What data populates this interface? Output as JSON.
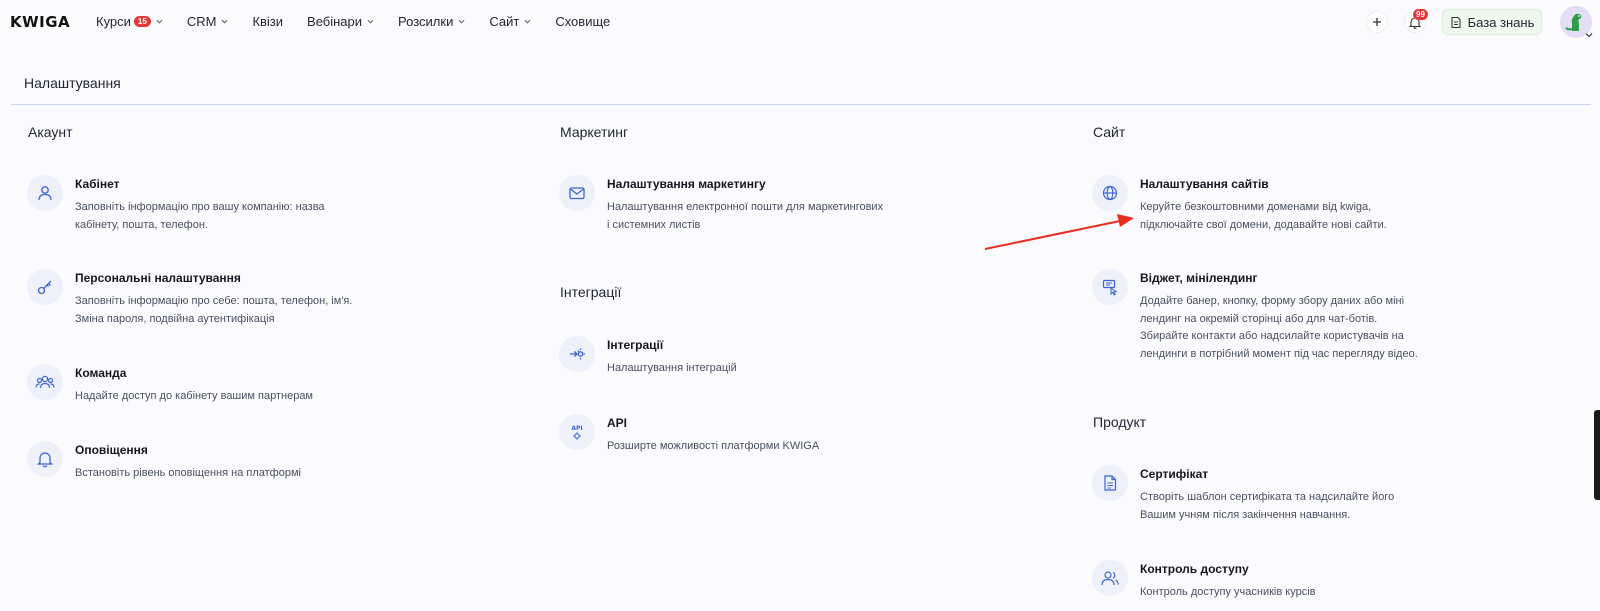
{
  "app": {
    "logo": "KWIGA",
    "nav": [
      {
        "label": "Курси",
        "badge": "15",
        "dropdown": true
      },
      {
        "label": "CRM",
        "dropdown": true
      },
      {
        "label": "Квізи",
        "dropdown": false
      },
      {
        "label": "Вебінари",
        "dropdown": true
      },
      {
        "label": "Розсилки",
        "dropdown": true
      },
      {
        "label": "Сайт",
        "dropdown": true
      },
      {
        "label": "Сховище",
        "dropdown": false
      }
    ],
    "notifications_count": "99",
    "knowledge_base_label": "База знань"
  },
  "page": {
    "title": "Налаштування"
  },
  "sections": {
    "account": {
      "title": "Акаунт",
      "items": [
        {
          "title": "Кабінет",
          "desc": "Заповніть інформацію про вашу компанію: назва\nкабінету, пошта, телефон.",
          "icon": "user-icon"
        },
        {
          "title": "Персональні налаштування",
          "desc": "Заповніть інформацію про себе: пошта, телефон, ім'я.\nЗміна пароля, подвійна аутентифікація",
          "icon": "key-icon"
        },
        {
          "title": "Команда",
          "desc": "Надайте доступ до кабінету вашим партнерам",
          "icon": "team-icon"
        },
        {
          "title": "Оповіщення",
          "desc": "Встановіть рівень оповіщення на платформі",
          "icon": "bell-icon"
        }
      ]
    },
    "marketing": {
      "title": "Маркетинг",
      "items": [
        {
          "title": "Налаштування маркетингу",
          "desc": "Налаштування електронної пошти для маркетингових\nі системних листів",
          "icon": "mail-icon"
        }
      ]
    },
    "integrations": {
      "title": "Інтеграції",
      "items": [
        {
          "title": "Інтеграції",
          "desc": "Налаштування інтеграцій",
          "icon": "integration-icon"
        },
        {
          "title": "API",
          "desc": "Розширте можливості платформи KWIGA",
          "icon": "api-icon"
        }
      ]
    },
    "site": {
      "title": "Сайт",
      "items": [
        {
          "title": "Налаштування сайтів",
          "desc": "Керуйте безкоштовними доменами від kwiga,\nпідключайте свої домени, додавайте нові сайти.",
          "icon": "globe-icon"
        },
        {
          "title": "Віджет, мінілендинг",
          "desc": "Додайте банер, кнопку, форму збору даних або міні\nлендинг на окремій сторінці або для чат-ботів.\nЗбирайте контакти або надсилайте користувачів на\nлендинги в потрібний момент під час перегляду відео.",
          "icon": "widget-icon"
        }
      ]
    },
    "product": {
      "title": "Продукт",
      "items": [
        {
          "title": "Сертифікат",
          "desc": "Створіть шаблон сертифіката та надсилайте його\nВашим учням після закінчення навчання.",
          "icon": "certificate-icon"
        },
        {
          "title": "Контроль доступу",
          "desc": "Контроль доступу учасників курсів",
          "icon": "access-icon"
        }
      ]
    }
  },
  "colors": {
    "accent": "#3f66d4",
    "arrow": "#e53020",
    "badge": "#e53935"
  }
}
